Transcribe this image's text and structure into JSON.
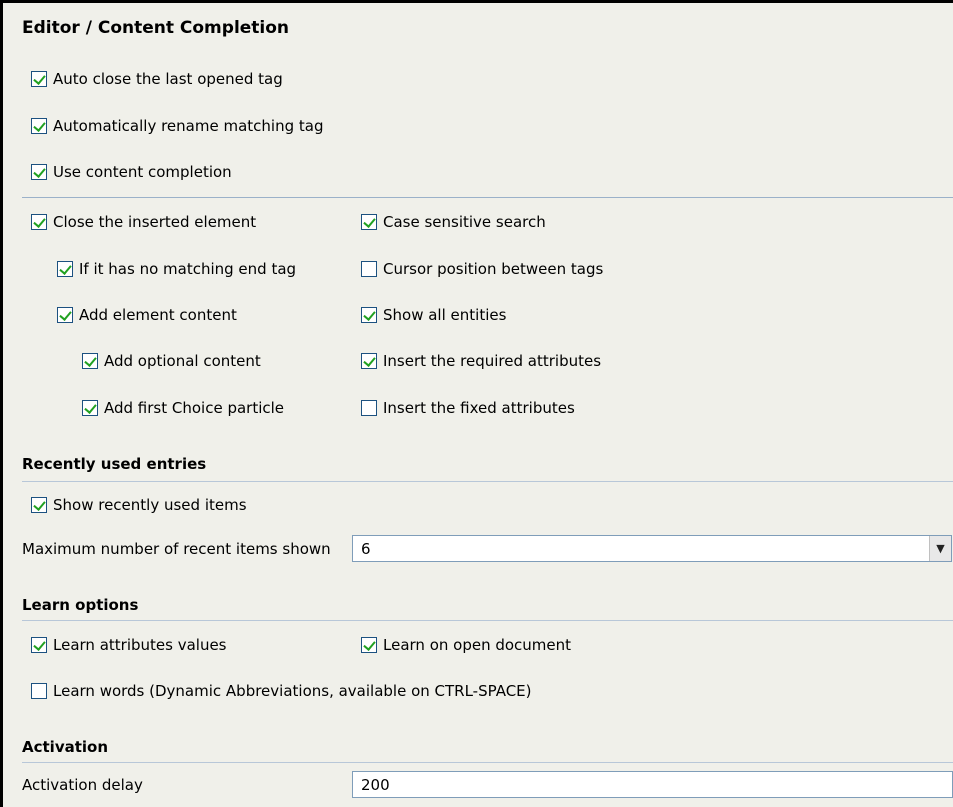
{
  "title": "Editor / Content Completion",
  "top_options": [
    {
      "label": "Auto close the last opened tag",
      "checked": true
    },
    {
      "label": "Automatically rename matching tag",
      "checked": true
    },
    {
      "label": "Use content completion",
      "checked": true
    }
  ],
  "completion_left": [
    {
      "label": "Close the inserted element",
      "checked": true
    },
    {
      "label": "If it has no matching end tag",
      "checked": true
    },
    {
      "label": "Add element content",
      "checked": true
    },
    {
      "label": "Add optional content",
      "checked": true
    },
    {
      "label": "Add first Choice particle",
      "checked": true
    }
  ],
  "completion_right": [
    {
      "label": "Case sensitive search",
      "checked": true
    },
    {
      "label": "Cursor position between tags",
      "checked": false
    },
    {
      "label": "Show all entities",
      "checked": true
    },
    {
      "label": "Insert the required attributes",
      "checked": true
    },
    {
      "label": "Insert the fixed attributes",
      "checked": false
    }
  ],
  "recent": {
    "heading": "Recently used entries",
    "show_label": "Show recently used items",
    "show_checked": true,
    "max_label": "Maximum number of recent items shown",
    "max_value": "6"
  },
  "learn": {
    "heading": "Learn options",
    "attributes_label": "Learn attributes values",
    "attributes_checked": true,
    "open_doc_label": "Learn on open document",
    "open_doc_checked": true,
    "words_label": "Learn words (Dynamic Abbreviations, available on CTRL-SPACE)",
    "words_checked": false
  },
  "activation": {
    "heading": "Activation",
    "delay_label": "Activation delay",
    "delay_value": "200"
  }
}
